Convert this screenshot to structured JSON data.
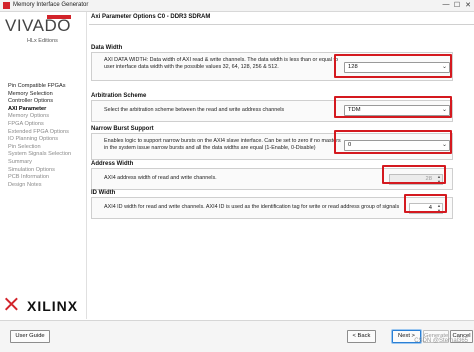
{
  "window": {
    "title": "Memory Interface Generator",
    "controls": [
      "—",
      "☐",
      "✕"
    ]
  },
  "logo": {
    "brand": "VIVADO",
    "edition": "HLx Editions"
  },
  "nav": {
    "items": [
      {
        "label": "Pin Compatible FPGAs",
        "state": "done"
      },
      {
        "label": "Memory Selection",
        "state": "done"
      },
      {
        "label": "Controller Options",
        "state": "done"
      },
      {
        "label": "AXI Parameter",
        "state": "current"
      },
      {
        "label": "Memory Options",
        "state": "todo"
      },
      {
        "label": "FPGA Options",
        "state": "todo"
      },
      {
        "label": "Extended FPGA Options",
        "state": "todo"
      },
      {
        "label": "IO Planning Options",
        "state": "todo"
      },
      {
        "label": "Pin Selection",
        "state": "todo"
      },
      {
        "label": "System Signals Selection",
        "state": "todo"
      },
      {
        "label": "Summary",
        "state": "todo"
      },
      {
        "label": "Simulation Options",
        "state": "todo"
      },
      {
        "label": "PCB Information",
        "state": "todo"
      },
      {
        "label": "Design Notes",
        "state": "todo"
      }
    ]
  },
  "footer_logo": {
    "word": "XILINX"
  },
  "main": {
    "header": "Axi Parameter Options C0 - DDR3 SDRAM",
    "sections": {
      "data_width": {
        "title": "Data Width",
        "desc1": "AXI DATA WIDTH: Data width of AXI read & write channels. The data width is less than or equal to",
        "desc2": "user interface data width with the possible values 32, 64, 128, 256 & 512.",
        "value": "128"
      },
      "arbitration": {
        "title": "Arbitration Scheme",
        "desc1": "Select the arbitration scheme between the read and write address channels",
        "value": "TDM"
      },
      "narrow_burst": {
        "title": "Narrow Burst Support",
        "desc1": "Enables logic to support narrow bursts on the AXI4 slave interface. Can be set to zero if no masters",
        "desc2": "in the system issue narrow bursts and all the data widths are equal (1-Enable, 0-Disable)",
        "value": "0"
      },
      "address_width": {
        "title": "Address Width",
        "desc1": "AXI4 address width of read and write channels.",
        "value": "28"
      },
      "id_width": {
        "title": "ID Width",
        "desc1": "AXI4 ID width for read and write channels. AXI4 ID is used as the identification tag for write or read address group of signals",
        "value": "4"
      }
    }
  },
  "buttons": {
    "user_guide": "User Guide",
    "back": "< Back",
    "next": "Next >",
    "generate": "Generate",
    "cancel": "Cancel"
  },
  "watermark": "CSDN @Sternal365",
  "colors": {
    "highlight": "#d4191f",
    "brand_red": "#d2232a"
  }
}
